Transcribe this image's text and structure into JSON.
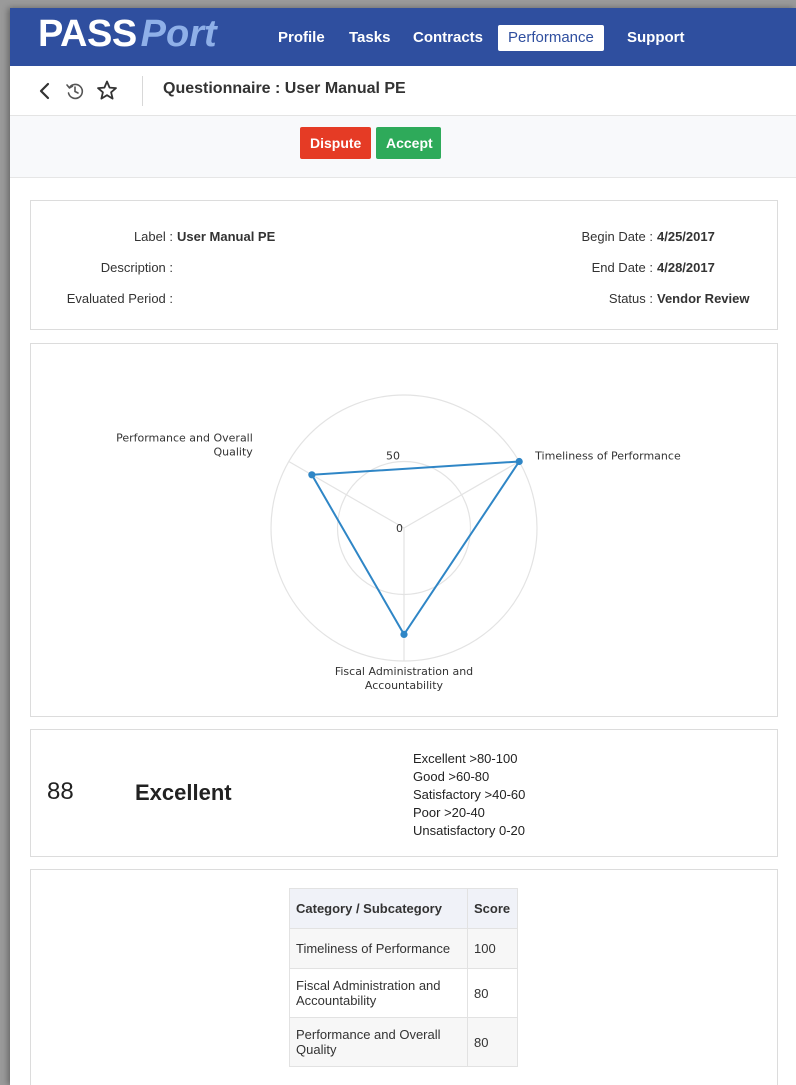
{
  "app": {
    "logo_part1": "PASS",
    "logo_part2": "Port"
  },
  "nav": {
    "items": [
      {
        "label": "Profile"
      },
      {
        "label": "Tasks"
      },
      {
        "label": "Contracts"
      },
      {
        "label": "Performance",
        "active": true
      },
      {
        "label": "Support"
      }
    ]
  },
  "toolbar": {
    "back_icon": "chevron-left-icon",
    "history_icon": "history-icon",
    "favorite_icon": "star-icon",
    "title": "Questionnaire : User Manual PE"
  },
  "actions": {
    "dispute_label": "Dispute",
    "accept_label": "Accept",
    "dispute_color": "#e53b25",
    "accept_color": "#2eaa5a"
  },
  "info": {
    "label_key": "Label :",
    "label_value": "User Manual PE",
    "description_key": "Description :",
    "description_value": "",
    "evaluated_period_key": "Evaluated Period :",
    "evaluated_period_value": "",
    "begin_date_key": "Begin Date :",
    "begin_date_value": "4/25/2017",
    "end_date_key": "End Date :",
    "end_date_value": "4/28/2017",
    "status_key": "Status :",
    "status_value": "Vendor Review"
  },
  "chart_data": {
    "type": "radar",
    "axes": [
      "Timeliness of Performance",
      "Fiscal Administration and Accountability",
      "Performance and Overall Quality"
    ],
    "axis_label_lines": [
      [
        "Timeliness of Performance"
      ],
      [
        "Fiscal Administration and",
        "Accountability"
      ],
      [
        "Performance and Overall",
        "Quality"
      ]
    ],
    "values": [
      100,
      80,
      80
    ],
    "scale": [
      0,
      100
    ],
    "tick_labels": [
      "0",
      "50"
    ],
    "line_color": "#2f86c6",
    "grid": true
  },
  "score": {
    "value": "88",
    "rating": "Excellent",
    "legend": [
      "Excellent >80-100",
      "Good >60-80",
      "Satisfactory >40-60",
      "Poor >20-40",
      "Unsatisfactory 0-20"
    ]
  },
  "table": {
    "headers": [
      "Category / Subcategory",
      "Score"
    ],
    "rows": [
      {
        "category": "Timeliness of Performance",
        "score": "100"
      },
      {
        "category": "Fiscal Administration and Accountability",
        "score": "80"
      },
      {
        "category": "Performance and Overall Quality",
        "score": "80"
      }
    ]
  }
}
